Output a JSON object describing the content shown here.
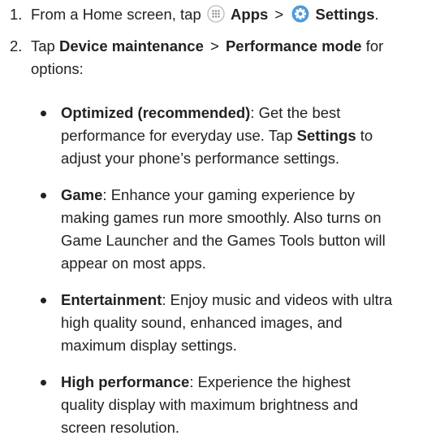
{
  "step1": {
    "number": "1.",
    "prefix": "From a Home screen, tap",
    "apps_label": "Apps",
    "separator": ">",
    "settings_label": "Settings",
    "suffix": "."
  },
  "step2": {
    "number": "2.",
    "prefix": "Tap",
    "device_maintenance": "Device maintenance",
    "separator": ">",
    "performance_mode": "Performance mode",
    "suffix": "for options:"
  },
  "options": [
    {
      "term": "Optimized (recommended)",
      "desc_before": ": Get the best performance for everyday use. Tap",
      "desc_bold": "Settings",
      "desc_after": "to adjust your phone’s performance settings."
    },
    {
      "term": "Game",
      "desc": ": Enhance your gaming experience by making games run more smoothly. Also turns on Game Launcher and the Games Tools button will appear on most apps."
    },
    {
      "term": "Entertainment",
      "desc": ": Enjoy music and videos with ultra high quality sound, enhanced images, and maximum display settings."
    },
    {
      "term": "High performance",
      "desc": ": Experience the highest quality display with maximum brightness and screen resolution."
    }
  ],
  "icons": {
    "apps": "apps-grid-icon",
    "settings": "settings-gear-icon",
    "settings_color": "#4f9ad8",
    "apps_border_color": "#b8b8b8"
  }
}
